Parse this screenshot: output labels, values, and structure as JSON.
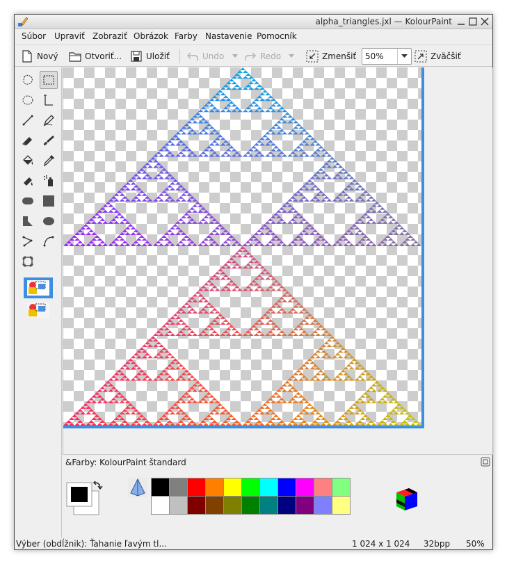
{
  "window": {
    "title": "alpha_triangles.jxl — KolourPaint",
    "controls": [
      "minimize-icon",
      "maximize-icon",
      "close-icon"
    ]
  },
  "menu": [
    {
      "id": "file",
      "label": "Súbor"
    },
    {
      "id": "edit",
      "label": "Upraviť"
    },
    {
      "id": "view",
      "label": "Zobraziť"
    },
    {
      "id": "image",
      "label": "Obrázok"
    },
    {
      "id": "colors",
      "label": "Farby"
    },
    {
      "id": "settings",
      "label": "Nastavenie"
    },
    {
      "id": "help",
      "label": "Pomocník"
    }
  ],
  "toolbar": {
    "new_label": "Nový",
    "open_label": "Otvoriť...",
    "save_label": "Uložiť",
    "undo_label": "Undo",
    "redo_label": "Redo",
    "zoom_out_label": "Zmenšiť",
    "zoom_value": "50%",
    "zoom_in_label": "Zväčšiť"
  },
  "tools": [
    "free-form-selection-icon",
    "rectangular-selection-icon",
    "elliptical-selection-icon",
    "text-icon",
    "line-icon",
    "pen-icon",
    "eraser-icon",
    "brush-icon",
    "flood-fill-icon",
    "color-picker-icon",
    "color-eraser-icon",
    "spraycan-icon",
    "rounded-rectangle-icon",
    "rectangle-icon",
    "polygon-icon",
    "ellipse-icon",
    "polyline-icon",
    "curve-icon",
    "zoom-icon"
  ],
  "selected_tool": "rectangular-selection-icon",
  "tool_options": [
    "opaque-selection-icon",
    "transparent-selection-icon"
  ],
  "palette": {
    "title": "&Farby: KolourPaint štandard",
    "foreground_color": "#000000",
    "background_color": "#ffffff",
    "row1": [
      "#000000",
      "#808080",
      "#ff0000",
      "#ff8000",
      "#ffff00",
      "#00ff00",
      "#00ffff",
      "#0000ff",
      "#ff00ff",
      "#ff8080",
      "#80ff80"
    ],
    "row2": [
      "#ffffff",
      "#c0c0c0",
      "#800000",
      "#804000",
      "#808000",
      "#008000",
      "#008080",
      "#000080",
      "#800080",
      "#8080ff",
      "#ffff80"
    ]
  },
  "canvas": {
    "gradient_corners": {
      "top_left": "#0066ff",
      "top_right": "#00ff33",
      "bottom_left": "#ff00a0",
      "bottom_right": "#a6ff00"
    },
    "selection_color": "#3d8ee0"
  },
  "status": {
    "message": "Výber (obdĺžnik): Ťahanie ľavým tl...",
    "dimensions": "1 024 x 1 024",
    "depth": "32bpp",
    "zoom": "50%"
  }
}
